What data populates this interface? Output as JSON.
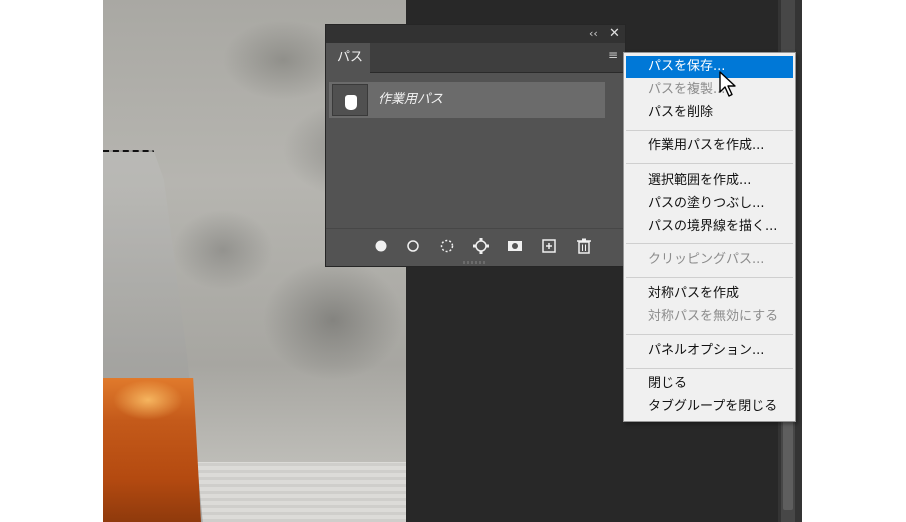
{
  "panel": {
    "tab_label": "パス",
    "path_item_name": "作業用パス"
  },
  "context_menu": {
    "items": [
      {
        "label": "パスを保存...",
        "state": "highlighted"
      },
      {
        "label": "パスを複製...",
        "state": "disabled"
      },
      {
        "label": "パスを削除",
        "state": "enabled"
      },
      {
        "label": "作業用パスを作成...",
        "state": "enabled"
      },
      {
        "label": "選択範囲を作成...",
        "state": "enabled"
      },
      {
        "label": "パスの塗りつぶし...",
        "state": "enabled"
      },
      {
        "label": "パスの境界線を描く...",
        "state": "enabled"
      },
      {
        "label": "クリッピングパス...",
        "state": "disabled"
      },
      {
        "label": "対称パスを作成",
        "state": "enabled"
      },
      {
        "label": "対称パスを無効にする",
        "state": "disabled"
      },
      {
        "label": "パネルオプション...",
        "state": "enabled"
      },
      {
        "label": "閉じる",
        "state": "enabled"
      },
      {
        "label": "タブグループを閉じる",
        "state": "enabled"
      }
    ]
  },
  "icons": {
    "panel_bottom": [
      "fill-path-icon",
      "stroke-path-icon",
      "load-as-selection-icon",
      "make-work-path-icon",
      "add-mask-icon",
      "new-path-icon",
      "delete-path-icon"
    ]
  },
  "colors": {
    "menu_highlight": "#0078d7",
    "panel_bg": "#535353",
    "workspace_bg": "#282828"
  }
}
